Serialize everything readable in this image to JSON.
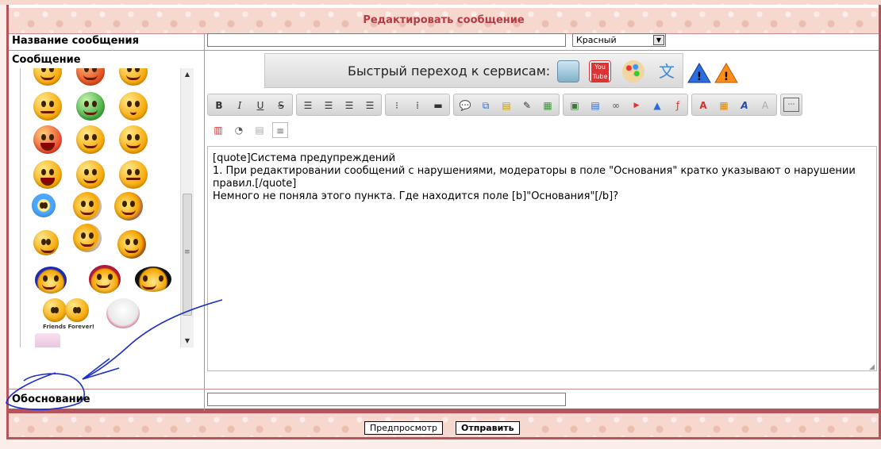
{
  "form": {
    "title": "Редактировать сообщение",
    "subject_label": "Название сообщения",
    "subject_value": "",
    "color_select": "Красный",
    "message_label": "Сообщение",
    "reason_label": "Обоснование",
    "reason_value": ""
  },
  "services": {
    "label": "Быстрый переход к сервисам:",
    "icons": [
      "image-service-icon",
      "youtube-service-icon",
      "palette-service-icon",
      "translate-service-icon",
      "warning-blue-icon",
      "warning-orange-icon"
    ],
    "youtube_text": "You Tube"
  },
  "toolbar": {
    "bold": "B",
    "italic": "I",
    "underline": "U",
    "strike": "S"
  },
  "smileys": {
    "friends_caption": "Friends Forever!"
  },
  "editor": {
    "content": "[quote]Система предупреждений\n1. При редактировании сообщений с нарушениями, модераторы в поле \"Основания\" кратко указывают о нарушении правил.[/quote]\nНемного не поняла этого пункта. Где находится поле [b]\"Основания\"[/b]?"
  },
  "buttons": {
    "preview": "Предпросмотр",
    "submit": "Отправить"
  },
  "colors": {
    "border": "#b5545a",
    "title": "#b03c44",
    "annotation": "#1a2fc9"
  }
}
